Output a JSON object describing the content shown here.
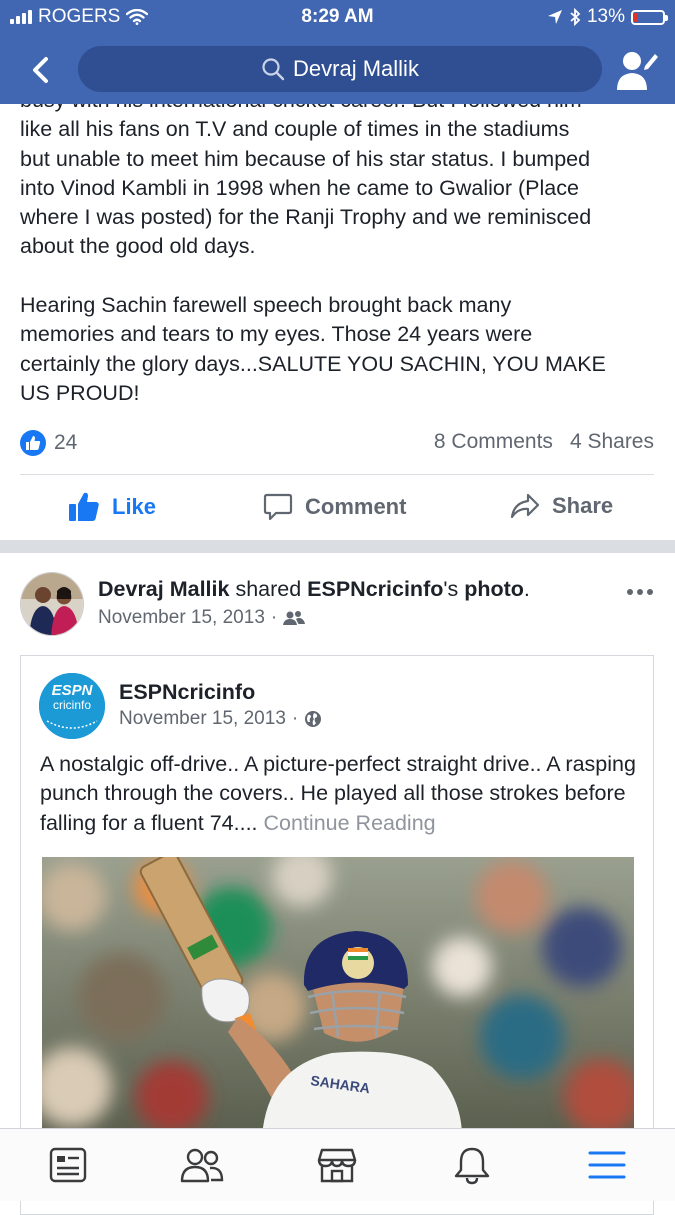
{
  "status_bar": {
    "carrier": "ROGERS",
    "time": "8:29 AM",
    "battery": "13%"
  },
  "header": {
    "search_query": "Devraj Mallik",
    "icons": [
      "back-icon",
      "search-icon",
      "profile-edit-icon"
    ]
  },
  "post1": {
    "paragraphs": [
      "busy with his international cricket career. But I followed him\nlike all his fans on T.V and couple of times in the stadiums\nbut unable to meet him because of his star status. I bumped\ninto Vinod Kambli in 1998 when he came to Gwalior (Place\nwhere I was posted) for the Ranji Trophy and we reminisced\nabout the good old days.",
      "Hearing Sachin farewell speech brought back many\nmemories and tears to my eyes. Those 24 years were\ncertainly the glory days...SALUTE YOU SACHIN, YOU MAKE\nUS PROUD!"
    ],
    "like_count": "24",
    "comments": "8 Comments",
    "shares": "4 Shares",
    "actions": {
      "like": "Like",
      "comment": "Comment",
      "share": "Share"
    }
  },
  "post2": {
    "author": "Devraj Mallik",
    "shared_word": " shared ",
    "source": "ESPNcricinfo",
    "possessive": "'s ",
    "object": "photo",
    "period": ".",
    "date": "November 15, 2013",
    "dot": "·",
    "audience_icon": "friends-icon",
    "shared": {
      "page_name": "ESPNcricinfo",
      "logo_text_top": "ESPN",
      "logo_text_bottom": "cricinfo",
      "date": "November 15, 2013",
      "dot": "·",
      "audience_icon": "globe-icon",
      "text": "A nostalgic off-drive.. A picture-perfect straight drive.. A rasping punch through the covers.. He played all those strokes before falling for a fluent 74.... ",
      "continue": "Continue Reading",
      "shirt_text": "SAHARA"
    }
  },
  "tabbar": {
    "icons": [
      "news-feed-icon",
      "friends-icon",
      "marketplace-icon",
      "notifications-icon",
      "menu-icon"
    ],
    "active_color": "#1877f2"
  },
  "colors": {
    "brand": "#4267b2",
    "link": "#1877f2",
    "muted": "#606770"
  }
}
